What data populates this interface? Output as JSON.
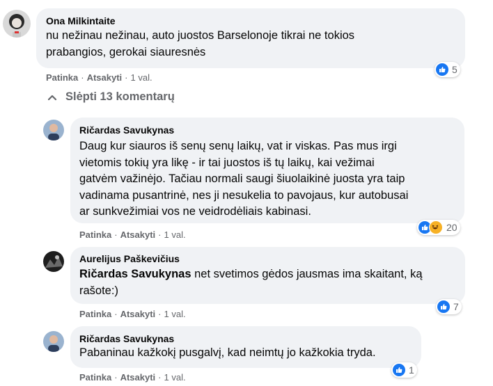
{
  "comments": [
    {
      "author": "Ona Milkintaite",
      "lines": [
        "nu nežinau nežinau, auto juostos Barselonoje tikrai ne tokios",
        "prabangios, gerokai siauresnės"
      ],
      "like_label": "Patinka",
      "reply_label": "Atsakyti",
      "time": "1 val.",
      "reactions": [
        "like"
      ],
      "reaction_count": "5"
    },
    {
      "author": "Ričardas Savukynas",
      "lines": [
        "Daug kur siauros iš senų senų laikų, vat ir viskas. Pas mus irgi",
        "vietomis tokių yra likę - ir tai juostos iš tų laikų, kai vežimai",
        "gatvėm važinėjo. Tačiau normali saugi šiuolaikinė juosta yra taip",
        "vadinama pusantrinė, nes ji nesukelia to pavojaus, kur autobusai",
        "ar sunkvežimiai vos ne veidrodėliais kabinasi."
      ],
      "like_label": "Patinka",
      "reply_label": "Atsakyti",
      "time": "1 val.",
      "reactions": [
        "like",
        "haha"
      ],
      "reaction_count": "20"
    },
    {
      "author": "Aurelijus Paškevičius",
      "mention": "Ričardas Savukynas",
      "line1_rest": " net svetimos gėdos jausmas ima skaitant, ką",
      "line2": "rašote:)",
      "like_label": "Patinka",
      "reply_label": "Atsakyti",
      "time": "1 val.",
      "reactions": [
        "like"
      ],
      "reaction_count": "7"
    },
    {
      "author": "Ričardas Savukynas",
      "lines": [
        "Pabaninau kažkokį pusgalvį, kad neimtų jo kažkokia tryda."
      ],
      "like_label": "Patinka",
      "reply_label": "Atsakyti",
      "time": "1 val.",
      "reactions": [
        "like"
      ],
      "reaction_count": "1"
    }
  ],
  "hide_replies_label": "Slėpti 13 komentarų",
  "separator": "·",
  "colors": {
    "bubble": "#f0f2f5",
    "like": "#1877f2",
    "meta": "#65676b",
    "haha": "#f7b125"
  }
}
